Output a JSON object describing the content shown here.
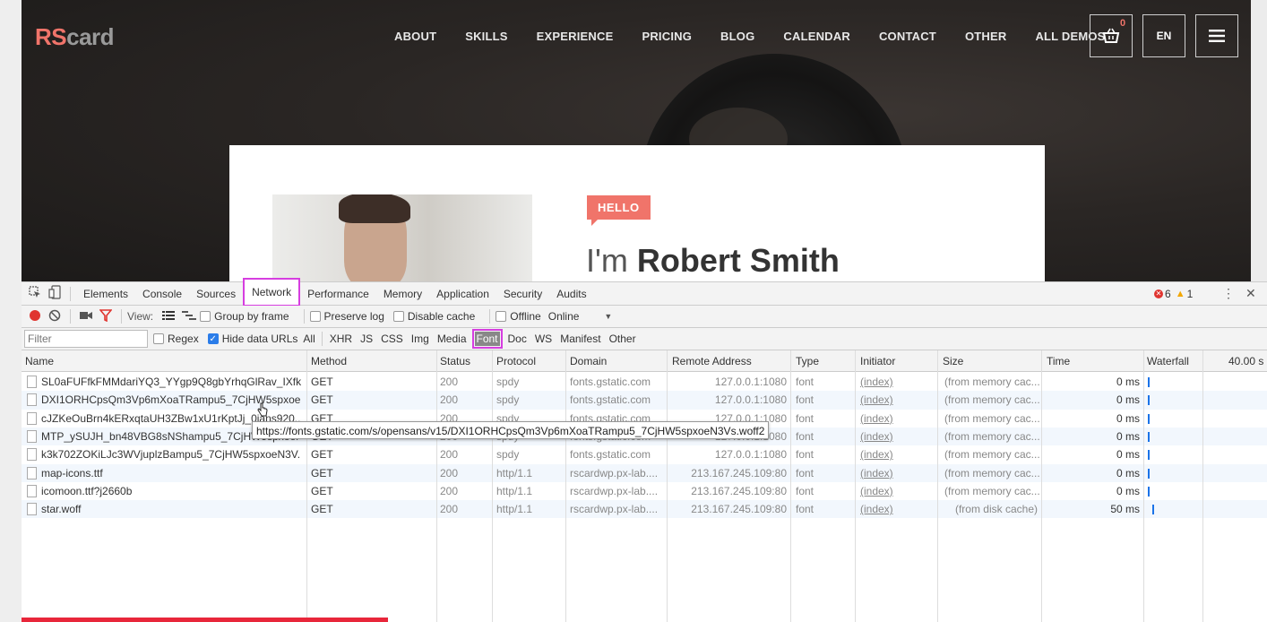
{
  "site": {
    "logo_rs": "RS",
    "logo_card": "card",
    "nav": [
      "ABOUT",
      "SKILLS",
      "EXPERIENCE",
      "PRICING",
      "BLOG",
      "CALENDAR",
      "CONTACT",
      "OTHER",
      "ALL DEMOS"
    ],
    "cart_count": "0",
    "language": "EN",
    "hello": "HELLO",
    "hero_prefix": "I'm ",
    "hero_name": "Robert Smith",
    "accent_color": "#f0746a"
  },
  "devtools": {
    "tabs": [
      "Elements",
      "Console",
      "Sources",
      "Network",
      "Performance",
      "Memory",
      "Application",
      "Security",
      "Audits"
    ],
    "active_tab": "Network",
    "errors": "6",
    "warnings": "1",
    "toolbar": {
      "view_label": "View:",
      "group_by_frame": "Group by frame",
      "preserve_log": "Preserve log",
      "disable_cache": "Disable cache",
      "offline": "Offline",
      "throttle": "Online"
    },
    "filter": {
      "placeholder": "Filter",
      "regex": "Regex",
      "hide_data_urls": "Hide data URLs",
      "types": [
        "All",
        "XHR",
        "JS",
        "CSS",
        "Img",
        "Media",
        "Font",
        "Doc",
        "WS",
        "Manifest",
        "Other"
      ],
      "selected_type": "Font"
    },
    "columns": [
      "Name",
      "Method",
      "Status",
      "Protocol",
      "Domain",
      "Remote Address",
      "Type",
      "Initiator",
      "Size",
      "Time",
      "Waterfall"
    ],
    "waterfall_scale": "40.00 s",
    "rows": [
      {
        "name": "SL0aFUFfkFMMdariYQ3_YYgp9Q8gbYrhqGlRav_IXfk...",
        "method": "GET",
        "status": "200",
        "protocol": "spdy",
        "domain": "fonts.gstatic.com",
        "remote": "127.0.0.1:1080",
        "type": "font",
        "initiator": "(index)",
        "size": "(from memory cac...",
        "time": "0 ms"
      },
      {
        "name": "DXI1ORHCpsQm3Vp6mXoaTRampu5_7CjHW5spxoe...",
        "method": "GET",
        "status": "200",
        "protocol": "spdy",
        "domain": "fonts.gstatic.com",
        "remote": "127.0.0.1:1080",
        "type": "font",
        "initiator": "(index)",
        "size": "(from memory cac...",
        "time": "0 ms"
      },
      {
        "name": "cJZKeOuBrn4kERxqtaUH3ZBw1xU1rKptJj_0jans920...",
        "method": "GET",
        "status": "200",
        "protocol": "spdy",
        "domain": "fonts.gstatic.com",
        "remote": "127.0.0.1:1080",
        "type": "font",
        "initiator": "(index)",
        "size": "(from memory cac...",
        "time": "0 ms"
      },
      {
        "name": "MTP_ySUJH_bn48VBG8sNShampu5_7CjHW5spxoeN3V...",
        "method": "GET",
        "status": "200",
        "protocol": "spdy",
        "domain": "fonts.gstatic.com",
        "remote": "127.0.0.1:1080",
        "type": "font",
        "initiator": "(index)",
        "size": "(from memory cac...",
        "time": "0 ms"
      },
      {
        "name": "k3k702ZOKiLJc3WVjuplzBampu5_7CjHW5spxoeN3V...",
        "method": "GET",
        "status": "200",
        "protocol": "spdy",
        "domain": "fonts.gstatic.com",
        "remote": "127.0.0.1:1080",
        "type": "font",
        "initiator": "(index)",
        "size": "(from memory cac...",
        "time": "0 ms"
      },
      {
        "name": "map-icons.ttf",
        "method": "GET",
        "status": "200",
        "protocol": "http/1.1",
        "domain": "rscardwp.px-lab....",
        "remote": "213.167.245.109:80",
        "type": "font",
        "initiator": "(index)",
        "size": "(from memory cac...",
        "time": "0 ms"
      },
      {
        "name": "icomoon.ttf?j2660b",
        "method": "GET",
        "status": "200",
        "protocol": "http/1.1",
        "domain": "rscardwp.px-lab....",
        "remote": "213.167.245.109:80",
        "type": "font",
        "initiator": "(index)",
        "size": "(from memory cac...",
        "time": "0 ms"
      },
      {
        "name": "star.woff",
        "method": "GET",
        "status": "200",
        "protocol": "http/1.1",
        "domain": "rscardwp.px-lab....",
        "remote": "213.167.245.109:80",
        "type": "font",
        "initiator": "(index)",
        "size": "(from disk cache)",
        "time": "50 ms"
      }
    ],
    "tooltip": "https://fonts.gstatic.com/s/opensans/v15/DXI1ORHCpsQm3Vp6mXoaTRampu5_7CjHW5spxoeN3Vs.woff2"
  }
}
